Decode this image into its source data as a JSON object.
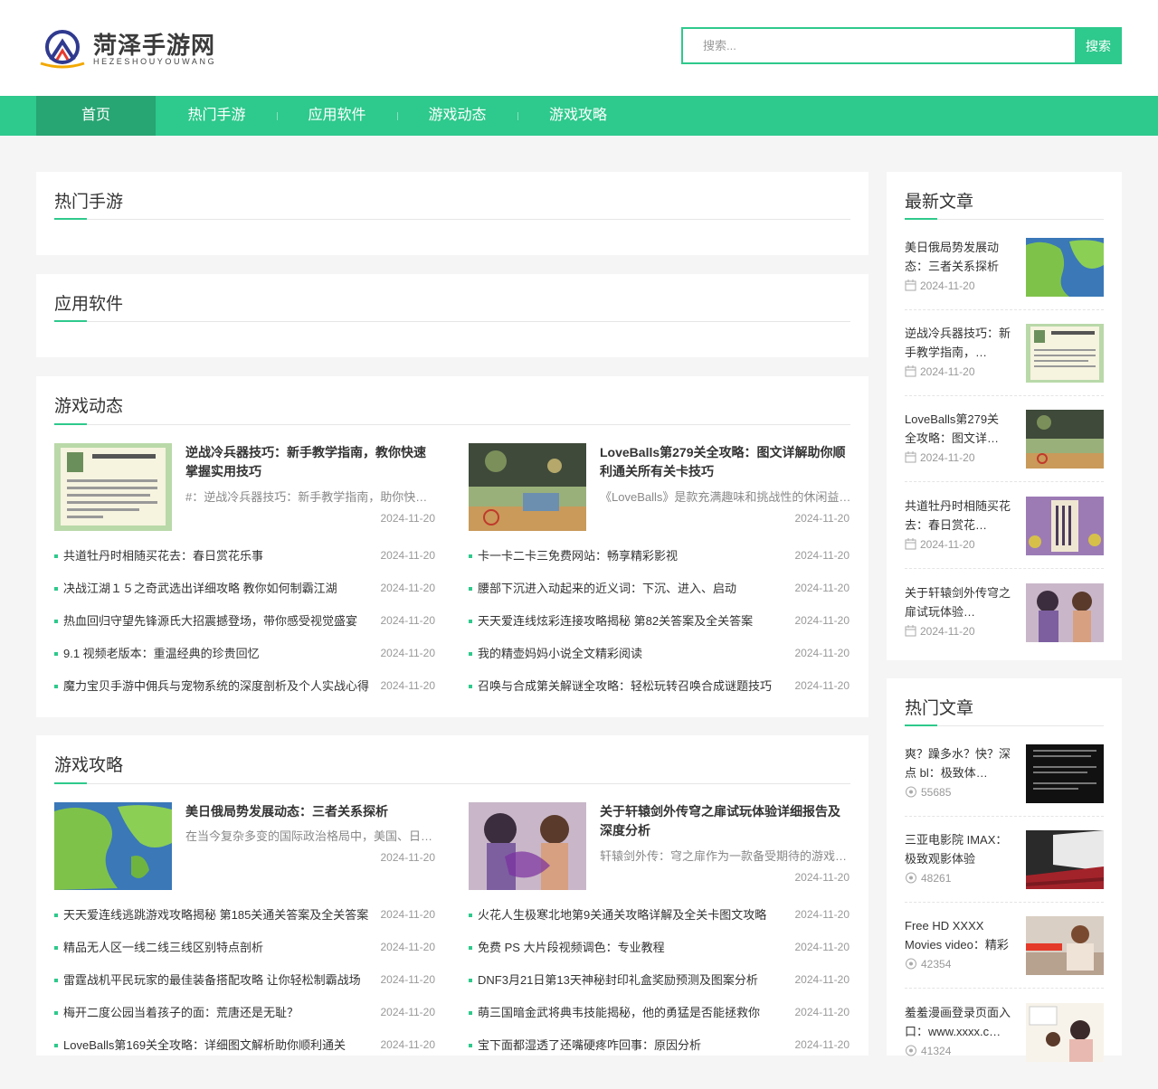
{
  "brand": {
    "name": "菏泽手游网",
    "sub": "HEZESHOUYOUWANG"
  },
  "search": {
    "placeholder": "搜索...",
    "button": "搜索"
  },
  "nav": [
    "首页",
    "热门手游",
    "应用软件",
    "游戏动态",
    "游戏攻略"
  ],
  "colors": {
    "accent": "#2ec98c",
    "accent_dark": "#27a572"
  },
  "sections": {
    "hot_games": {
      "title": "热门手游"
    },
    "apps": {
      "title": "应用软件"
    },
    "news": {
      "title": "游戏动态",
      "features": [
        {
          "title": "逆战冷兵器技巧：新手教学指南，教你快速掌握实用技巧",
          "desc": "#：逆战冷兵器技巧：新手教学指南，助你快速掌握实用技巧",
          "date": "2024-11-20"
        },
        {
          "title": "LoveBalls第279关全攻略：图文详解助你顺利通关所有关卡技巧",
          "desc": "《LoveBalls》是款充满趣味和挑战性的休闲益智游戏",
          "date": "2024-11-20"
        }
      ],
      "left": [
        {
          "title": "共道牡丹时相随买花去：春日赏花乐事",
          "date": "2024-11-20"
        },
        {
          "title": "决战江湖１５之奇武选出详细攻略 教你如何制霸江湖",
          "date": "2024-11-20"
        },
        {
          "title": "热血回归守望先锋源氏大招震撼登场，带你感受视觉盛宴",
          "date": "2024-11-20"
        },
        {
          "title": "9.1 视频老版本：重温经典的珍贵回忆",
          "date": "2024-11-20"
        },
        {
          "title": "魔力宝贝手游中佣兵与宠物系统的深度剖析及个人实战心得",
          "date": "2024-11-20"
        }
      ],
      "right": [
        {
          "title": "卡一卡二卡三免费网站：畅享精彩影视",
          "date": "2024-11-20"
        },
        {
          "title": "腰部下沉进入动起来的近义词：下沉、进入、启动",
          "date": "2024-11-20"
        },
        {
          "title": "天天爱连线炫彩连接攻略揭秘 第82关答案及全关答案",
          "date": "2024-11-20"
        },
        {
          "title": "我的精壶妈妈小说全文精彩阅读",
          "date": "2024-11-20"
        },
        {
          "title": "召唤与合成第关解谜全攻略：轻松玩转召唤合成谜题技巧",
          "date": "2024-11-20"
        }
      ]
    },
    "guides": {
      "title": "游戏攻略",
      "features": [
        {
          "title": "美日俄局势发展动态：三者关系探析",
          "desc": "在当今复杂多变的国际政治格局中，美国、日本和俄罗斯",
          "date": "2024-11-20"
        },
        {
          "title": "关于轩辕剑外传穹之扉试玩体验详细报告及深度分析",
          "desc": "轩辕剑外传：穹之扉作为一款备受期待的游戏作品",
          "date": "2024-11-20"
        }
      ],
      "left": [
        {
          "title": "天天爱连线逃跳游戏攻略揭秘 第185关通关答案及全关答案",
          "date": "2024-11-20"
        },
        {
          "title": "精品无人区一线二线三线区别特点剖析",
          "date": "2024-11-20"
        },
        {
          "title": "雷霆战机平民玩家的最佳装备搭配攻略 让你轻松制霸战场",
          "date": "2024-11-20"
        },
        {
          "title": "梅开二度公园当着孩子的面：荒唐还是无耻？",
          "date": "2024-11-20"
        },
        {
          "title": "LoveBalls第169关全攻略：详细图文解析助你顺利通关",
          "date": "2024-11-20"
        }
      ],
      "right": [
        {
          "title": "火花人生极寒北地第9关通关攻略详解及全关卡图文攻略",
          "date": "2024-11-20"
        },
        {
          "title": "免费 PS 大片段视频调色：专业教程",
          "date": "2024-11-20"
        },
        {
          "title": "DNF3月21日第13天神秘封印礼盒奖励预测及图案分析",
          "date": "2024-11-20"
        },
        {
          "title": "萌三国暗金武将典韦技能揭秘，他的勇猛是否能拯救你",
          "date": "2024-11-20"
        },
        {
          "title": "宝下面都湿透了还嘴硬疼咋回事：原因分析",
          "date": "2024-11-20"
        }
      ]
    }
  },
  "sidebar": {
    "latest": {
      "title": "最新文章",
      "items": [
        {
          "title": "美日俄局势发展动态：三者关系探析",
          "date": "2024-11-20"
        },
        {
          "title": "逆战冷兵器技巧：新手教学指南，…",
          "date": "2024-11-20"
        },
        {
          "title": "LoveBalls第279关全攻略：图文详…",
          "date": "2024-11-20"
        },
        {
          "title": "共道牡丹时相随买花去：春日赏花…",
          "date": "2024-11-20"
        },
        {
          "title": "关于轩辕剑外传穹之扉试玩体验…",
          "date": "2024-11-20"
        }
      ]
    },
    "hot": {
      "title": "热门文章",
      "items": [
        {
          "title": "爽？躁多水？快？深点 bl：极致体…",
          "views": "55685"
        },
        {
          "title": "三亚电影院 IMAX：极致观影体验",
          "views": "48261"
        },
        {
          "title": "Free HD XXXX Movies video：精彩电…",
          "views": "42354"
        },
        {
          "title": "羞羞漫画登录页面入口：www.xxxx.c…",
          "views": "41324"
        }
      ]
    }
  }
}
